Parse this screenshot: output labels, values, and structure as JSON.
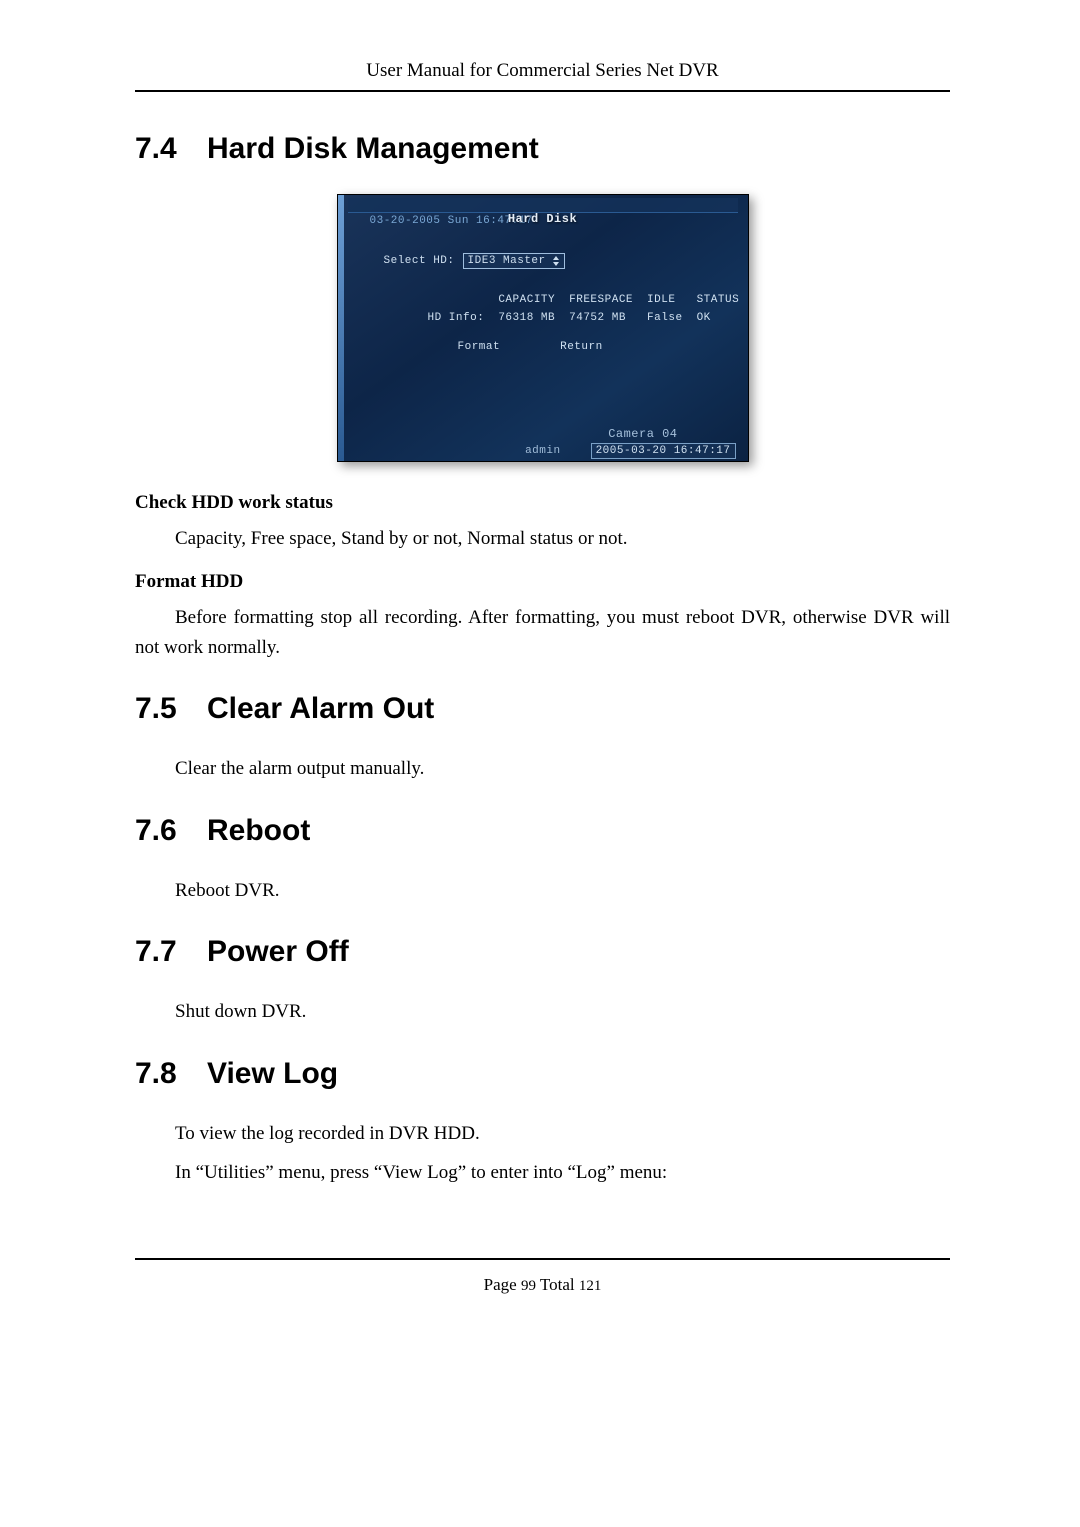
{
  "header": "User Manual for Commercial Series Net DVR",
  "sections": {
    "s74": {
      "num": "7.4",
      "title": "Hard Disk Management"
    },
    "s75": {
      "num": "7.5",
      "title": "Clear Alarm Out"
    },
    "s76": {
      "num": "7.6",
      "title": "Reboot"
    },
    "s77": {
      "num": "7.7",
      "title": "Power Off"
    },
    "s78": {
      "num": "7.8",
      "title": "View Log"
    }
  },
  "dvr": {
    "datetime": "03-20-2005 Sun 16:47:17",
    "title": "Hard Disk",
    "select_label": "Select HD:",
    "select_value": "IDE3 Master",
    "col_capacity": "CAPACITY",
    "col_freespace": "FREESPACE",
    "col_idle": "IDLE",
    "col_status": "STATUS",
    "row_label": "HD Info:",
    "capacity": "76318 MB",
    "freespace": "74752 MB",
    "idle": "False",
    "status": "OK",
    "btn_format": "Format",
    "btn_return": "Return",
    "camera": "Camera 04",
    "user": "admin",
    "timestamp": "2005-03-20 16:47:17"
  },
  "text": {
    "check_hdd_heading": "Check HDD work status",
    "check_hdd_body": "Capacity, Free space, Stand by or not, Normal status or not.",
    "format_hdd_heading": "Format HDD",
    "format_hdd_body": "Before formatting stop all recording. After formatting, you must reboot DVR, otherwise DVR will not work normally.",
    "clear_alarm_body": "Clear the alarm output manually.",
    "reboot_body": "Reboot DVR.",
    "poweroff_body": "Shut down DVR.",
    "viewlog_body1": "To view the log recorded in DVR HDD.",
    "viewlog_body2": "In “Utilities” menu, press “View Log” to enter into “Log” menu:"
  },
  "footer": {
    "prefix": "Page ",
    "page": "99",
    "mid": " Total ",
    "total": "121"
  }
}
